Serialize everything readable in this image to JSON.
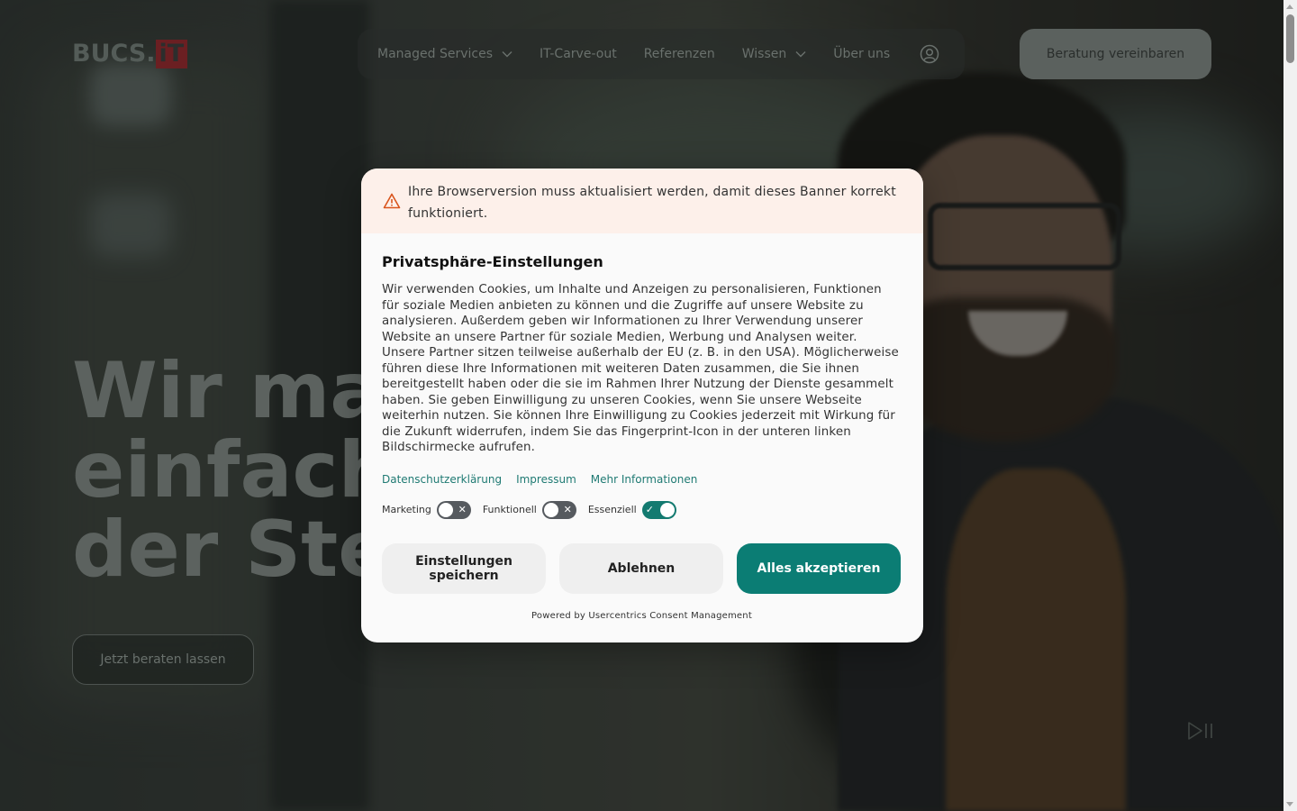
{
  "header": {
    "logo": {
      "part1": "BUCS.",
      "part2": "iT"
    },
    "nav": [
      {
        "label": "Managed Services",
        "has_dropdown": true
      },
      {
        "label": "IT-Carve-out",
        "has_dropdown": false
      },
      {
        "label": "Referenzen",
        "has_dropdown": false
      },
      {
        "label": "Wissen",
        "has_dropdown": true
      },
      {
        "label": "Über uns",
        "has_dropdown": false
      }
    ],
    "user_icon": "user-circle-icon",
    "cta_label": "Beratung vereinbaren"
  },
  "hero": {
    "headline": "Wir mach\neinfach w\nder Steck",
    "cta_label": "Jetzt beraten lassen",
    "media_control_icon": "play-pause-icon"
  },
  "consent": {
    "warning_icon": "warning-triangle-icon",
    "warning_text": "Ihre Browserversion muss aktualisiert werden, damit dieses Banner korrekt funktioniert.",
    "title": "Privatsphäre-Einstellungen",
    "description": "Wir verwenden Cookies, um Inhalte und Anzeigen zu personalisieren, Funktionen für soziale Medien anbieten zu können und die Zugriffe auf unsere Website zu analysieren. Außerdem geben wir Informationen zu Ihrer Verwendung unserer Website an unsere Partner für soziale Medien, Werbung und Analysen weiter. Unsere Partner sitzen teilweise außerhalb der EU (z. B. in den USA). Möglicherweise führen diese Ihre Informationen mit weiteren Daten zusammen, die Sie ihnen bereitgestellt haben oder die sie im Rahmen Ihrer Nutzung der Dienste gesammelt haben. Sie geben Einwilligung zu unseren Cookies, wenn Sie unsere Webseite weiterhin nutzen. Sie können Ihre Einwilligung zu Cookies jederzeit mit Wirkung für die Zukunft widerrufen, indem Sie das Fingerprint-Icon in der unteren linken Bildschirmecke aufrufen.",
    "links": [
      "Datenschutzerklärung",
      "Impressum",
      "Mehr Informationen"
    ],
    "toggles": [
      {
        "label": "Marketing",
        "on": false
      },
      {
        "label": "Funktionell",
        "on": false
      },
      {
        "label": "Essenziell",
        "on": true
      }
    ],
    "buttons": {
      "save": "Einstellungen speichern",
      "reject": "Ablehnen",
      "accept": "Alles akzeptieren"
    },
    "powered_by": "Powered by Usercentrics Consent Management"
  },
  "colors": {
    "accent": "#0b7d74",
    "warning_bg": "#fdf0ea",
    "logo_red": "#6b1f22"
  }
}
